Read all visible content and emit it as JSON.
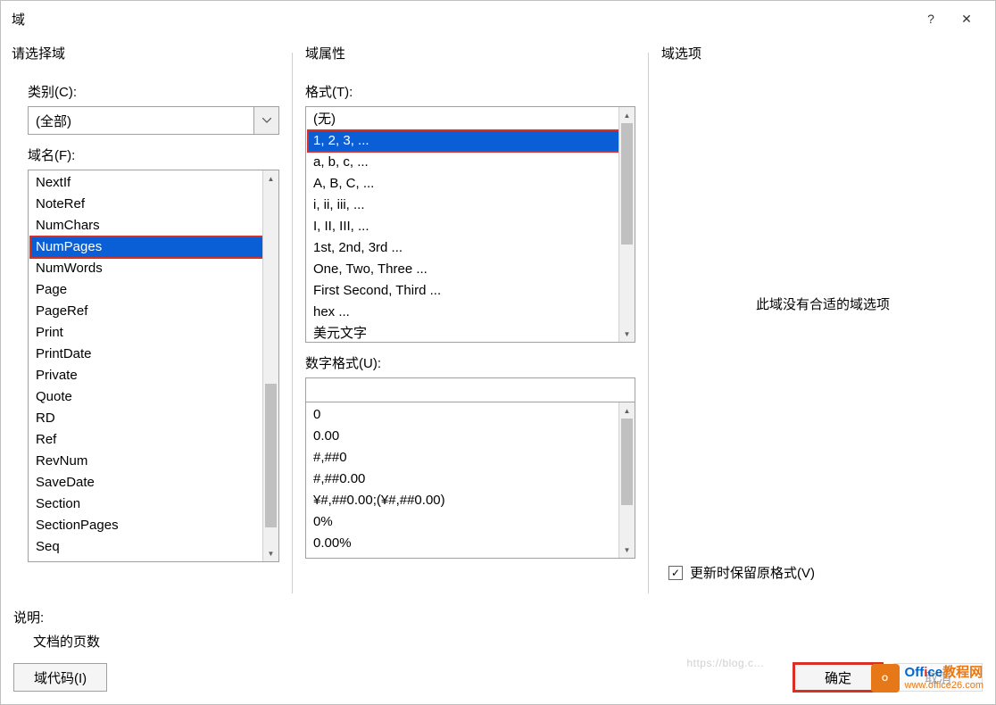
{
  "title": "域",
  "help_icon": "?",
  "close_icon": "✕",
  "panels": {
    "left": {
      "heading": "请选择域",
      "category_label": "类别(C):",
      "category_value": "(全部)",
      "field_label": "域名(F):",
      "fields": [
        "NextIf",
        "NoteRef",
        "NumChars",
        "NumPages",
        "NumWords",
        "Page",
        "PageRef",
        "Print",
        "PrintDate",
        "Private",
        "Quote",
        "RD",
        "Ref",
        "RevNum",
        "SaveDate",
        "Section",
        "SectionPages",
        "Seq"
      ],
      "field_selected": "NumPages"
    },
    "mid": {
      "heading": "域属性",
      "format_label": "格式(T):",
      "formats": [
        "(无)",
        "1, 2, 3, ...",
        "a, b, c, ...",
        "A, B, C, ...",
        "i, ii, iii, ...",
        "I, II, III, ...",
        "1st, 2nd, 3rd ...",
        "One, Two, Three ...",
        "First Second, Third ...",
        "hex ...",
        "美元文字"
      ],
      "format_selected": "1, 2, 3, ...",
      "num_format_label": "数字格式(U):",
      "num_format_value": "",
      "num_formats": [
        "0",
        "0.00",
        "#,##0",
        "#,##0.00",
        "¥#,##0.00;(¥#,##0.00)",
        "0%",
        "0.00%"
      ]
    },
    "right": {
      "heading": "域选项",
      "message": "此域没有合适的域选项",
      "checkbox_label": "更新时保留原格式(V)",
      "checkbox_checked": "✓"
    }
  },
  "description": {
    "label": "说明:",
    "text": "文档的页数"
  },
  "buttons": {
    "field_codes": "域代码(I)",
    "ok": "确定",
    "cancel": "取消"
  },
  "watermark": {
    "brand1": "Off",
    "brand2": "i",
    "brand3": "ce",
    "brand4": "教程网",
    "url": "www.office26.com"
  },
  "faint_text": "https://blog.c..."
}
